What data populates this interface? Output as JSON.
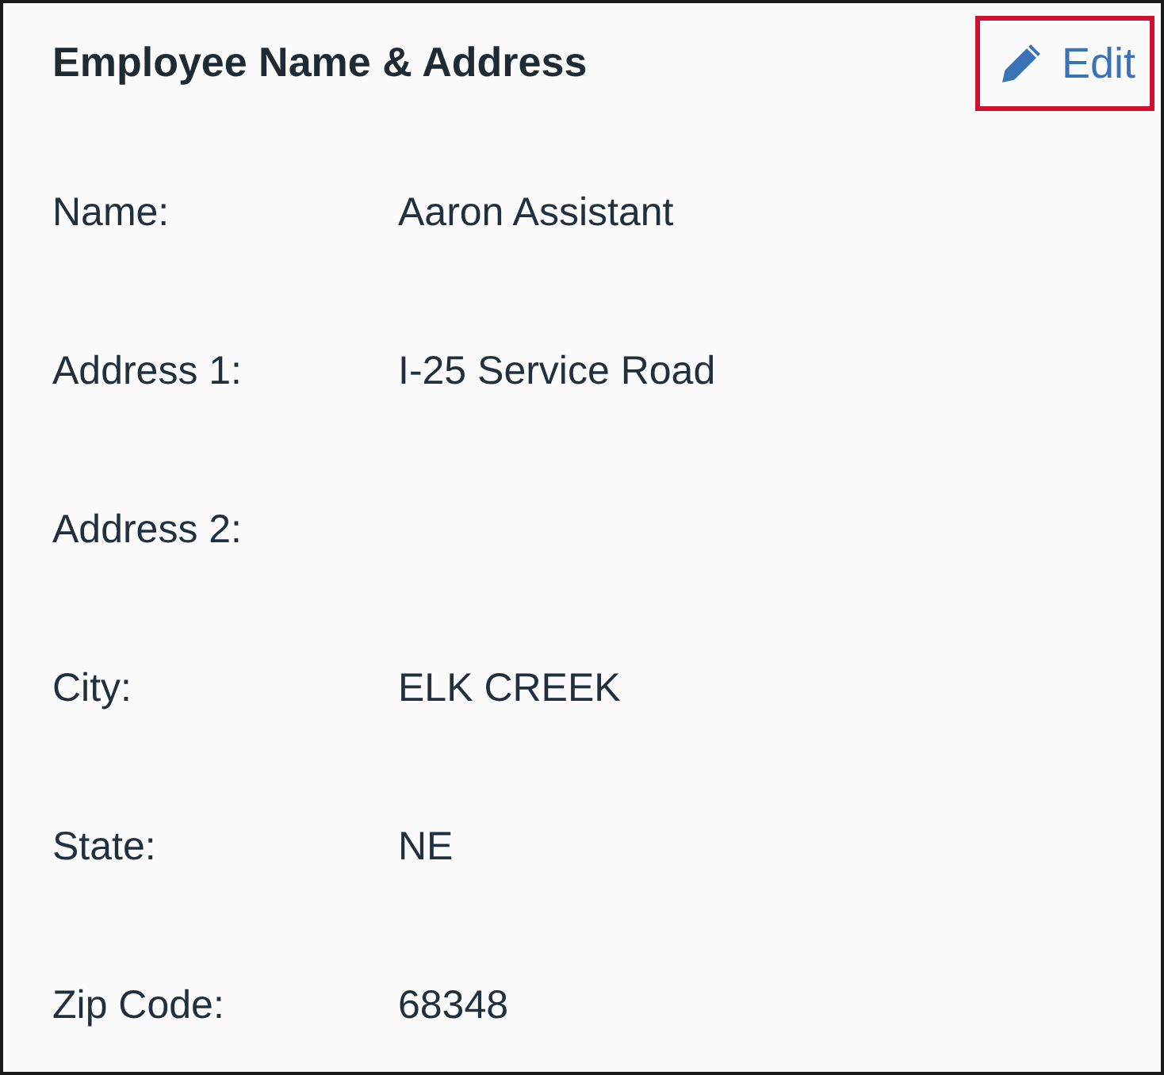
{
  "card": {
    "title": "Employee Name & Address",
    "edit_button": {
      "label": "Edit",
      "highlighted": true
    }
  },
  "fields": [
    {
      "label": "Name:",
      "value": "Aaron Assistant"
    },
    {
      "label": "Address 1:",
      "value": "I-25 Service Road"
    },
    {
      "label": "Address 2:"
    },
    {
      "label": "City:",
      "value": "ELK CREEK"
    },
    {
      "label": "State:",
      "value": "NE"
    },
    {
      "label": "Zip Code:",
      "value": "68348"
    }
  ]
}
